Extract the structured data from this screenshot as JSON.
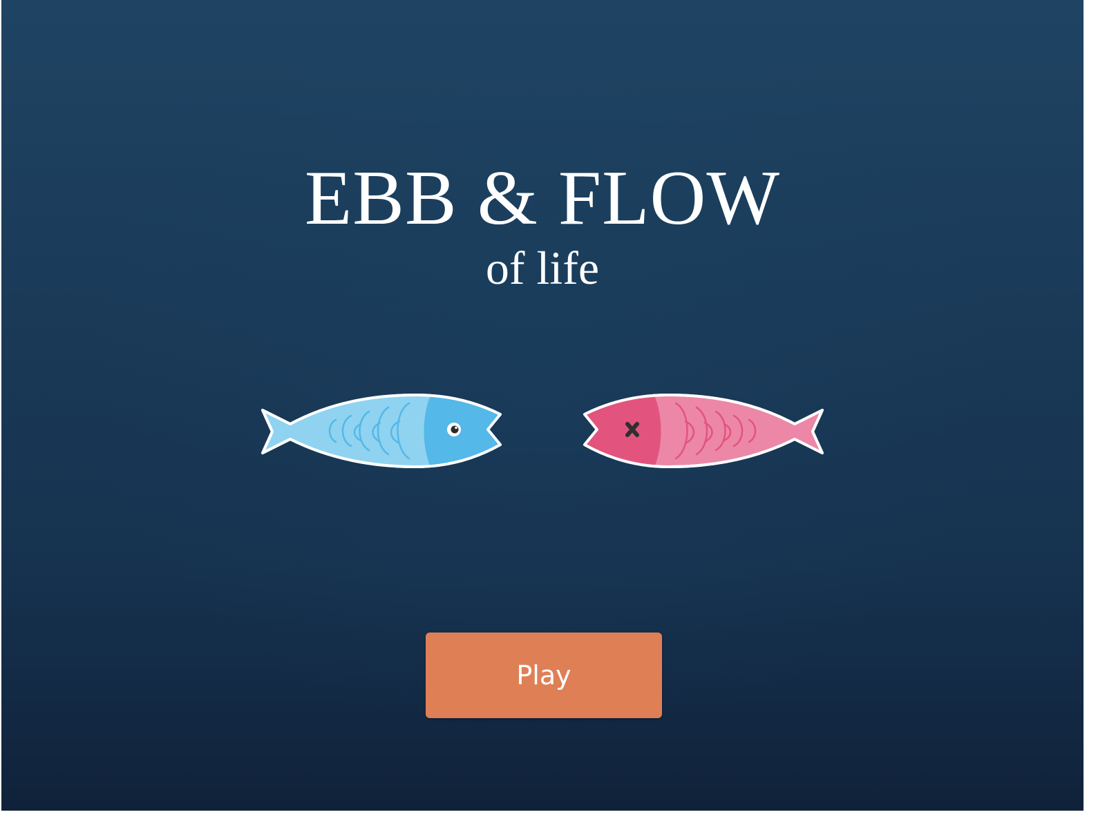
{
  "title": "EBB & FLOW",
  "subtitle": "of life",
  "play_label": "Play",
  "colors": {
    "background_top": "#1f4463",
    "background_bottom": "#10223a",
    "blue_fish_body": "#8fd3f0",
    "blue_fish_head": "#54b8e8",
    "pink_fish_body": "#ec87a8",
    "pink_fish_head": "#e2547e",
    "button": "#df7f56"
  },
  "fish": [
    {
      "name": "blue-fish",
      "state": "alive",
      "eye": "eye-icon"
    },
    {
      "name": "pink-fish",
      "state": "dead",
      "eye": "x-eye-icon"
    }
  ]
}
